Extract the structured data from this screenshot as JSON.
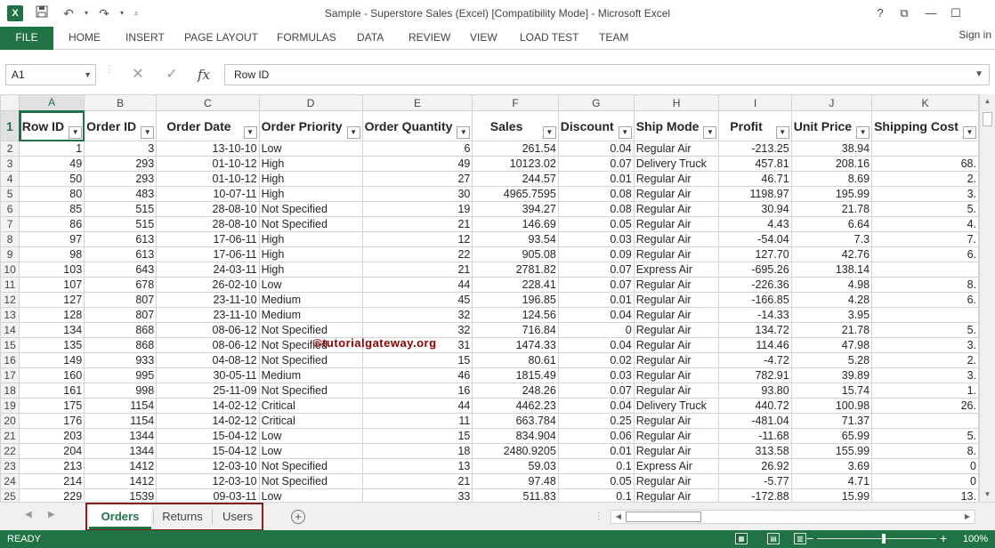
{
  "window": {
    "title": "Sample - Superstore Sales (Excel)  [Compatibility Mode] - Microsoft Excel",
    "app_icon": "X",
    "controls": [
      "?",
      "⧉",
      "—",
      "☐"
    ]
  },
  "ribbon": {
    "file": "FILE",
    "tabs": [
      "HOME",
      "INSERT",
      "PAGE LAYOUT",
      "FORMULAS",
      "DATA",
      "REVIEW",
      "VIEW",
      "LOAD TEST",
      "TEAM"
    ],
    "signin": "Sign in"
  },
  "formula_bar": {
    "name_box": "A1",
    "cancel_icon": "✕",
    "enter_icon": "✓",
    "fx": "fx",
    "value": "Row ID"
  },
  "columns": [
    "A",
    "B",
    "C",
    "D",
    "E",
    "F",
    "G",
    "H",
    "I",
    "J",
    "K"
  ],
  "headers": [
    "Row ID",
    "Order ID",
    "Order Date",
    "Order Priority",
    "Order Quantity",
    "Sales",
    "Discount",
    "Ship Mode",
    "Profit",
    "Unit Price",
    "Shipping Cost"
  ],
  "rows": [
    [
      "1",
      "3",
      "13-10-10",
      "Low",
      "6",
      "261.54",
      "0.04",
      "Regular Air",
      "-213.25",
      "38.94",
      ""
    ],
    [
      "49",
      "293",
      "01-10-12",
      "High",
      "49",
      "10123.02",
      "0.07",
      "Delivery Truck",
      "457.81",
      "208.16",
      "68."
    ],
    [
      "50",
      "293",
      "01-10-12",
      "High",
      "27",
      "244.57",
      "0.01",
      "Regular Air",
      "46.71",
      "8.69",
      "2."
    ],
    [
      "80",
      "483",
      "10-07-11",
      "High",
      "30",
      "4965.7595",
      "0.08",
      "Regular Air",
      "1198.97",
      "195.99",
      "3."
    ],
    [
      "85",
      "515",
      "28-08-10",
      "Not Specified",
      "19",
      "394.27",
      "0.08",
      "Regular Air",
      "30.94",
      "21.78",
      "5."
    ],
    [
      "86",
      "515",
      "28-08-10",
      "Not Specified",
      "21",
      "146.69",
      "0.05",
      "Regular Air",
      "4.43",
      "6.64",
      "4."
    ],
    [
      "97",
      "613",
      "17-06-11",
      "High",
      "12",
      "93.54",
      "0.03",
      "Regular Air",
      "-54.04",
      "7.3",
      "7."
    ],
    [
      "98",
      "613",
      "17-06-11",
      "High",
      "22",
      "905.08",
      "0.09",
      "Regular Air",
      "127.70",
      "42.76",
      "6."
    ],
    [
      "103",
      "643",
      "24-03-11",
      "High",
      "21",
      "2781.82",
      "0.07",
      "Express Air",
      "-695.26",
      "138.14",
      ""
    ],
    [
      "107",
      "678",
      "26-02-10",
      "Low",
      "44",
      "228.41",
      "0.07",
      "Regular Air",
      "-226.36",
      "4.98",
      "8."
    ],
    [
      "127",
      "807",
      "23-11-10",
      "Medium",
      "45",
      "196.85",
      "0.01",
      "Regular Air",
      "-166.85",
      "4.28",
      "6."
    ],
    [
      "128",
      "807",
      "23-11-10",
      "Medium",
      "32",
      "124.56",
      "0.04",
      "Regular Air",
      "-14.33",
      "3.95",
      ""
    ],
    [
      "134",
      "868",
      "08-06-12",
      "Not Specified",
      "32",
      "716.84",
      "0",
      "Regular Air",
      "134.72",
      "21.78",
      "5."
    ],
    [
      "135",
      "868",
      "08-06-12",
      "Not Specified",
      "31",
      "1474.33",
      "0.04",
      "Regular Air",
      "114.46",
      "47.98",
      "3."
    ],
    [
      "149",
      "933",
      "04-08-12",
      "Not Specified",
      "15",
      "80.61",
      "0.02",
      "Regular Air",
      "-4.72",
      "5.28",
      "2."
    ],
    [
      "160",
      "995",
      "30-05-11",
      "Medium",
      "46",
      "1815.49",
      "0.03",
      "Regular Air",
      "782.91",
      "39.89",
      "3."
    ],
    [
      "161",
      "998",
      "25-11-09",
      "Not Specified",
      "16",
      "248.26",
      "0.07",
      "Regular Air",
      "93.80",
      "15.74",
      "1."
    ],
    [
      "175",
      "1154",
      "14-02-12",
      "Critical",
      "44",
      "4462.23",
      "0.04",
      "Delivery Truck",
      "440.72",
      "100.98",
      "26."
    ],
    [
      "176",
      "1154",
      "14-02-12",
      "Critical",
      "11",
      "663.784",
      "0.25",
      "Regular Air",
      "-481.04",
      "71.37",
      ""
    ],
    [
      "203",
      "1344",
      "15-04-12",
      "Low",
      "15",
      "834.904",
      "0.06",
      "Regular Air",
      "-11.68",
      "65.99",
      "5."
    ],
    [
      "204",
      "1344",
      "15-04-12",
      "Low",
      "18",
      "2480.9205",
      "0.01",
      "Regular Air",
      "313.58",
      "155.99",
      "8."
    ],
    [
      "213",
      "1412",
      "12-03-10",
      "Not Specified",
      "13",
      "59.03",
      "0.1",
      "Express Air",
      "26.92",
      "3.69",
      "0"
    ],
    [
      "214",
      "1412",
      "12-03-10",
      "Not Specified",
      "21",
      "97.48",
      "0.05",
      "Regular Air",
      "-5.77",
      "4.71",
      "0"
    ],
    [
      "229",
      "1539",
      "09-03-11",
      "Low",
      "33",
      "511.83",
      "0.1",
      "Regular Air",
      "-172.88",
      "15.99",
      "13."
    ]
  ],
  "watermark": "©tutorialgateway.org",
  "sheets": {
    "tabs": [
      "Orders",
      "Returns",
      "Users"
    ],
    "active": "Orders"
  },
  "status": {
    "ready": "READY",
    "zoom": "100%",
    "zoom_level": 0.5
  }
}
